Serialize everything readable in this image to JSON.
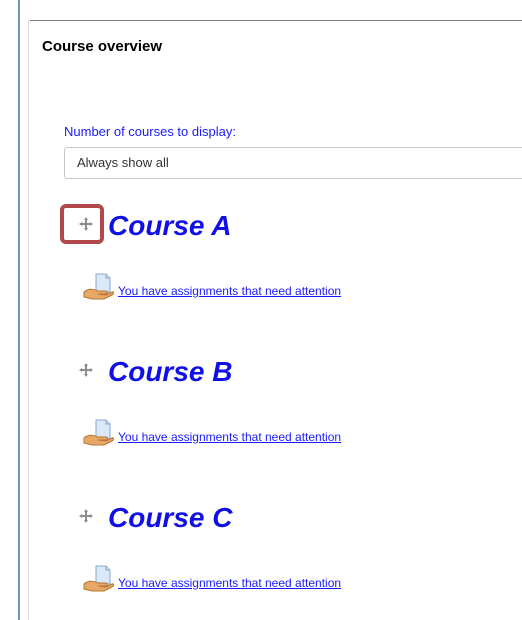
{
  "block": {
    "title": "Course overview",
    "display_label": "Number of courses to display:",
    "display_selected": "Always show all"
  },
  "courses": [
    {
      "name": "Course A",
      "assignment_text": "You have assignments that need attention",
      "highlighted": true
    },
    {
      "name": "Course B",
      "assignment_text": "You have assignments that need attention",
      "highlighted": false
    },
    {
      "name": "Course C",
      "assignment_text": "You have assignments that need attention",
      "highlighted": false
    }
  ],
  "icons": {
    "move": "move-arrows-icon",
    "assignment": "assignment-hand-icon"
  },
  "colors": {
    "link": "#1a1aff",
    "course_title": "#1010e6",
    "highlight": "#b1484b"
  }
}
